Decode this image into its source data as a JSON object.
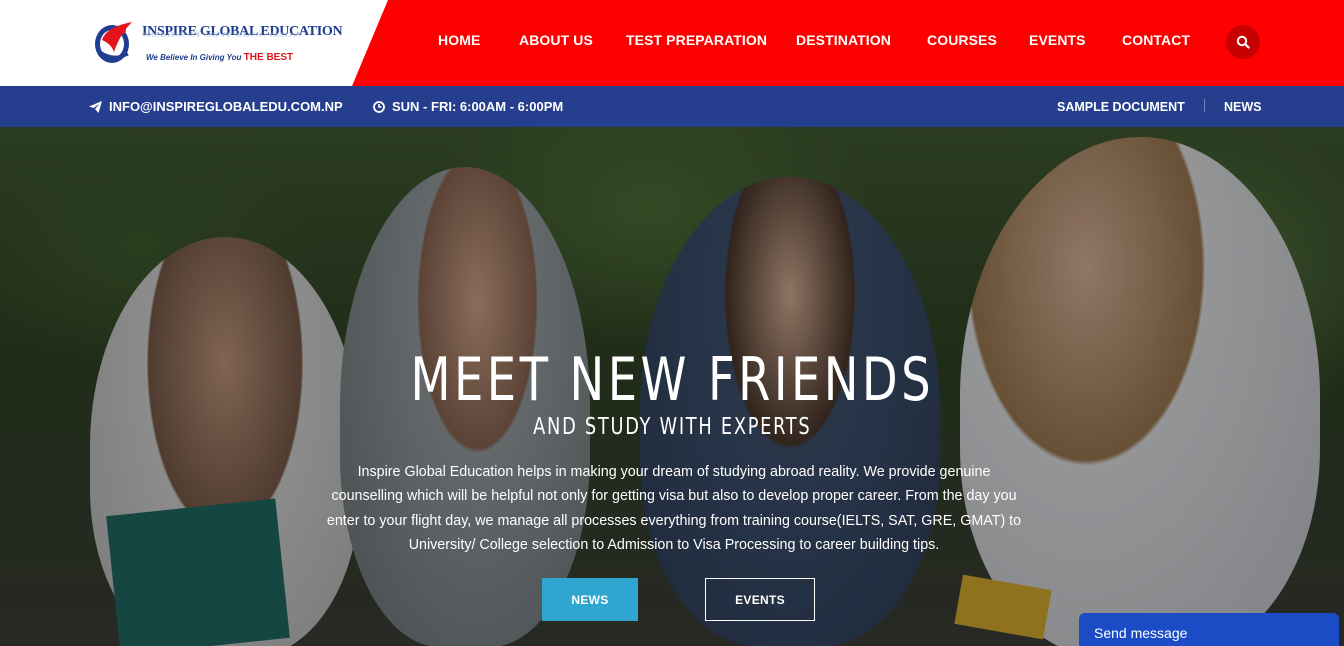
{
  "header": {
    "logo": {
      "title": "INSPIRE GLOBAL EDUCATION",
      "tagline": "We Believe In Giving You",
      "tagline_emphasis": "THE BEST"
    },
    "nav": [
      "HOME",
      "ABOUT US",
      "TEST PREPARATION",
      "DESTINATION",
      "COURSES",
      "EVENTS",
      "CONTACT"
    ],
    "search_icon": "search-icon",
    "colors": {
      "bar": "#fe0000",
      "search_bg": "#c90000"
    }
  },
  "infobar": {
    "email": "INFO@INSPIREGLOBALEDU.COM.NP",
    "hours": "SUN - FRI: 6:00AM - 6:00PM",
    "links": [
      "SAMPLE DOCUMENT",
      "NEWS"
    ],
    "colors": {
      "bg": "#253f8e"
    }
  },
  "hero": {
    "title": "MEET NEW FRIENDS",
    "subtitle": "AND STUDY WITH EXPERTS",
    "description": "Inspire Global Education helps in making your dream of studying abroad reality. We provide genuine counselling which will be helpful not only for getting visa but also to develop proper career. From the day you enter to your flight day, we manage all processes everything from training course(IELTS, SAT, GRE, GMAT) to University/ College selection to Admission to Visa Processing to career building tips.",
    "buttons": {
      "news": "NEWS",
      "events": "EVENTS"
    },
    "colors": {
      "news_button": "#2ea6cf"
    }
  },
  "chat": {
    "label": "Send message",
    "color": "#1b4cc6"
  }
}
